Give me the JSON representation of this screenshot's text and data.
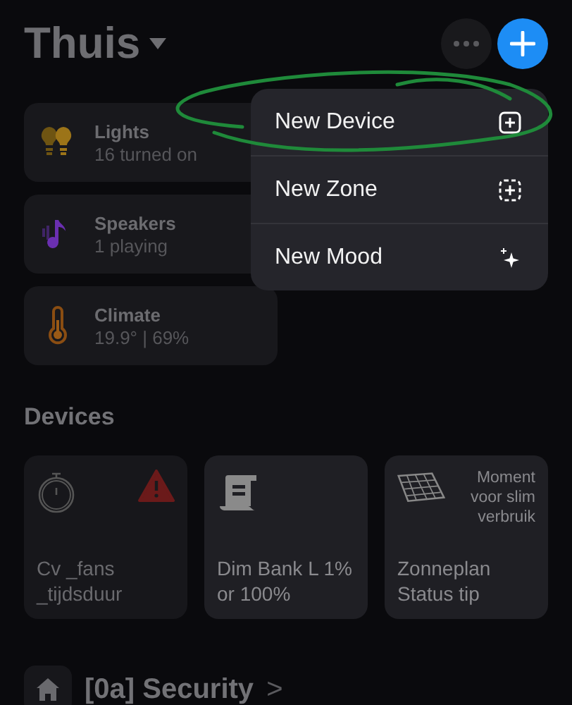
{
  "header": {
    "title": "Thuis"
  },
  "categories": [
    {
      "kind": "lights",
      "name": "Lights",
      "status": "16 turned on"
    },
    {
      "kind": "speakers",
      "name": "Speakers",
      "status": "1 playing"
    },
    {
      "kind": "climate",
      "name": "Climate",
      "status": "19.9° | 69%"
    }
  ],
  "menu": [
    {
      "kind": "device",
      "label": "New Device"
    },
    {
      "kind": "zone",
      "label": "New Zone"
    },
    {
      "kind": "mood",
      "label": "New Mood"
    }
  ],
  "devices_section": {
    "title": "Devices"
  },
  "devices": [
    {
      "kind": "timer",
      "name": "Cv _fans _tijdsduur",
      "warning": true
    },
    {
      "kind": "script",
      "name": "Dim Bank L 1% or 100%",
      "warning": false
    },
    {
      "kind": "solar",
      "name": "Zonneplan Status tip",
      "warning": false,
      "note": "Moment voor slim verbruik"
    }
  ],
  "zone": {
    "title": "[0a] Security",
    "chevron": ">"
  }
}
